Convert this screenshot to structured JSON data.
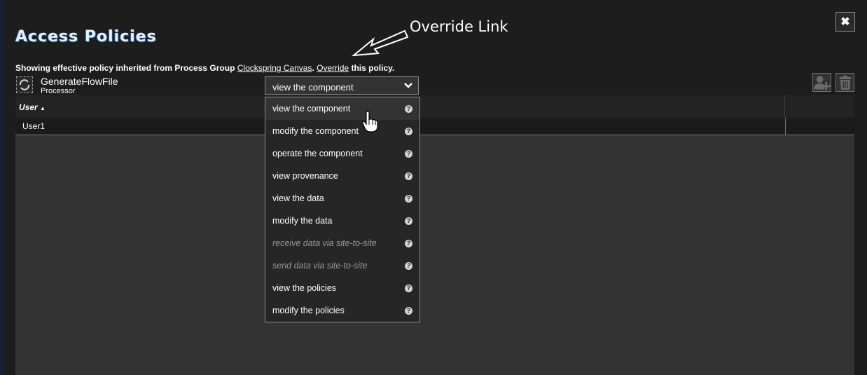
{
  "dialog": {
    "title": "Access Policies",
    "close_icon": "close-icon"
  },
  "annotation": {
    "label": "Override Link"
  },
  "info": {
    "prefix": "Showing effective policy inherited from Process Group ",
    "group_link": "Clockspring Canvas",
    "separator": ". ",
    "override_link": "Override",
    "suffix": " this policy."
  },
  "component": {
    "name": "GenerateFlowFile",
    "type": "Processor",
    "icon": "processor-icon"
  },
  "policy_select": {
    "selected": "view the component",
    "options": [
      {
        "label": "view the component",
        "disabled": false,
        "hovered": true
      },
      {
        "label": "modify the component",
        "disabled": false
      },
      {
        "label": "operate the component",
        "disabled": false
      },
      {
        "label": "view provenance",
        "disabled": false
      },
      {
        "label": "view the data",
        "disabled": false
      },
      {
        "label": "modify the data",
        "disabled": false
      },
      {
        "label": "receive data via site-to-site",
        "disabled": true
      },
      {
        "label": "send data via site-to-site",
        "disabled": true
      },
      {
        "label": "view the policies",
        "disabled": false
      },
      {
        "label": "modify the policies",
        "disabled": false
      }
    ]
  },
  "actions": {
    "add_user_icon": "add-user-icon",
    "delete_icon": "trash-icon"
  },
  "grid": {
    "columns": [
      {
        "label": "User",
        "sort": "ascending"
      }
    ],
    "rows": [
      {
        "user": "User1"
      }
    ]
  }
}
